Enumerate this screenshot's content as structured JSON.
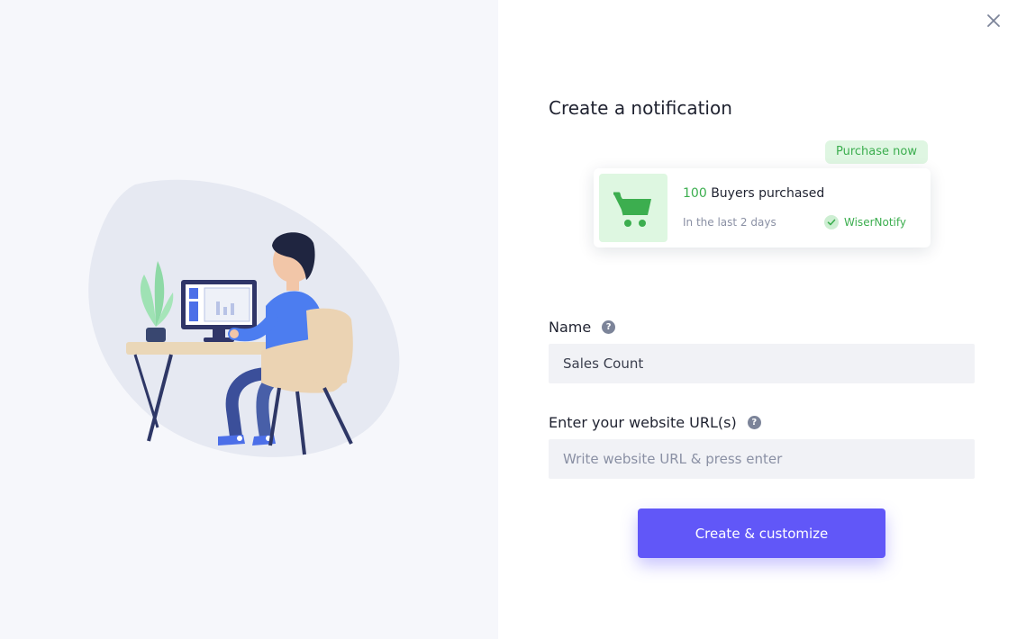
{
  "dialog": {
    "title": "Create a notification",
    "close_icon": "close-icon"
  },
  "preview": {
    "badge": "Purchase now",
    "count": "100",
    "headline": "Buyers purchased",
    "subtext": "In the last 2 days",
    "brand": "WiserNotify",
    "cart_icon": "shopping-cart-icon",
    "check_icon": "check-icon",
    "colors": {
      "accent_green": "#3cae4f",
      "badge_bg": "#dff6e2"
    }
  },
  "form": {
    "name_label": "Name",
    "name_value": "Sales Count",
    "url_label": "Enter your website URL(s)",
    "url_placeholder": "Write website URL & press enter",
    "help_icon": "question-circle-icon",
    "submit_label": "Create & customize",
    "colors": {
      "primary": "#6157f8",
      "input_bg": "#f1f2f6"
    }
  },
  "illustration": {
    "name": "person-at-desk-illustration"
  }
}
